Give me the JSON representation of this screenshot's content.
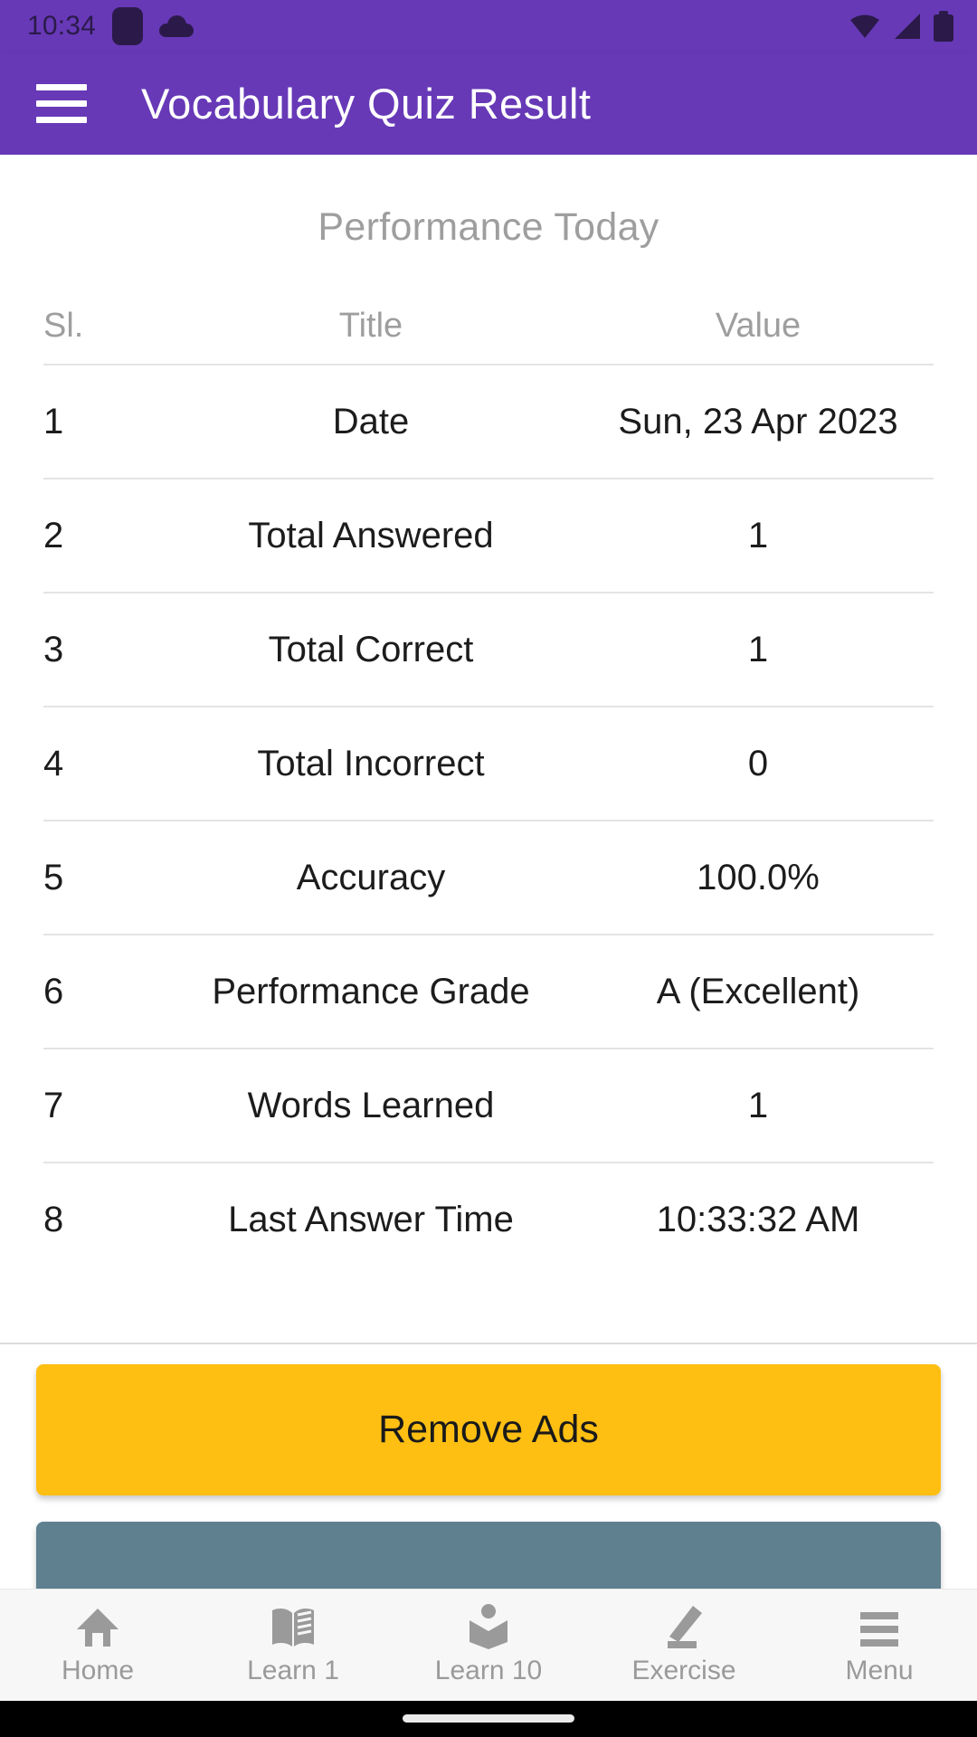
{
  "status_bar": {
    "time": "10:34",
    "left_icons": [
      "app-badge-icon",
      "cloud-icon"
    ],
    "right_icons": [
      "wifi-icon",
      "signal-icon",
      "battery-icon"
    ],
    "icon_color": "#2b1a49"
  },
  "app_bar": {
    "menu_icon": "hamburger-menu-icon",
    "title": "Vocabulary Quiz Result",
    "background": "#6739B7",
    "text_color": "#FFFFFF"
  },
  "content": {
    "section_title": "Performance Today",
    "table": {
      "headers": {
        "sl": "Sl.",
        "title": "Title",
        "value": "Value"
      },
      "rows": [
        {
          "sl": "1",
          "title": "Date",
          "value": "Sun, 23 Apr 2023"
        },
        {
          "sl": "2",
          "title": "Total Answered",
          "value": "1"
        },
        {
          "sl": "3",
          "title": "Total Correct",
          "value": "1"
        },
        {
          "sl": "4",
          "title": "Total Incorrect",
          "value": "0"
        },
        {
          "sl": "5",
          "title": "Accuracy",
          "value": "100.0%"
        },
        {
          "sl": "6",
          "title": "Performance Grade",
          "value": "A (Excellent)"
        },
        {
          "sl": "7",
          "title": "Words Learned",
          "value": "1"
        },
        {
          "sl": "8",
          "title": "Last Answer Time",
          "value": "10:33:32 AM"
        }
      ]
    }
  },
  "buttons": {
    "remove_ads_label": "Remove Ads",
    "remove_ads_color": "#FFBF12",
    "secondary_color": "#5E808F"
  },
  "bottom_nav": {
    "items": [
      {
        "label": "Home",
        "icon": "home-icon"
      },
      {
        "label": "Learn 1",
        "icon": "open-book-icon"
      },
      {
        "label": "Learn 10",
        "icon": "reading-person-icon"
      },
      {
        "label": "Exercise",
        "icon": "pencil-icon"
      },
      {
        "label": "Menu",
        "icon": "hamburger-menu-icon"
      }
    ],
    "inactive_color": "#9a9a9a"
  }
}
